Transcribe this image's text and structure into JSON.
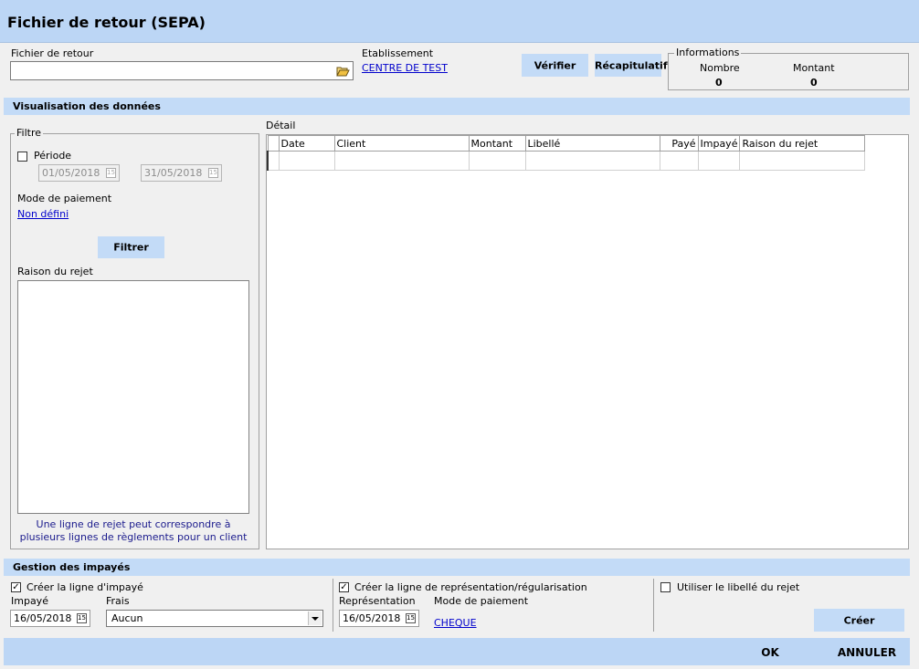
{
  "window": {
    "title": "Fichier de retour (SEPA)"
  },
  "header": {
    "fichier_label": "Fichier de retour",
    "fichier_value": "",
    "etablissement_label": "Etablissement",
    "etablissement_value": "CENTRE DE TEST",
    "verifier_label": "Vérifier",
    "recap_label": "Récapitulatif"
  },
  "informations": {
    "legend": "Informations",
    "nombre_label": "Nombre",
    "nombre_value": "0",
    "montant_label": "Montant",
    "montant_value": "0"
  },
  "visualisation": {
    "title": "Visualisation des données"
  },
  "filtre": {
    "legend": "Filtre",
    "periode_label": "Période",
    "periode_checked": false,
    "date_from": "01/05/2018",
    "date_to": "31/05/2018",
    "mode_label": "Mode de paiement",
    "mode_value": "Non défini",
    "filtrer_label": "Filtrer",
    "raison_label": "Raison du rejet",
    "note": "Une ligne de rejet peut correspondre à plusieurs lignes de règlements pour un client"
  },
  "detail": {
    "label": "Détail",
    "columns": [
      "Date",
      "Client",
      "Montant",
      "Libellé",
      "Payé",
      "Impayé",
      "Raison du rejet"
    ]
  },
  "gestion": {
    "title": "Gestion des impayés",
    "creer_impaye_label": "Créer la ligne d'impayé",
    "creer_impaye_checked": true,
    "impaye_label": "Impayé",
    "impaye_date": "16/05/2018",
    "frais_label": "Frais",
    "frais_value": "Aucun",
    "creer_repr_label": "Créer la ligne de représentation/régularisation",
    "creer_repr_checked": true,
    "representation_label": "Représentation",
    "representation_date": "16/05/2018",
    "mode_label": "Mode de paiement",
    "mode_value": "CHEQUE",
    "utiliser_label": "Utiliser le libellé du rejet",
    "utiliser_checked": false,
    "creer_button": "Créer"
  },
  "footer": {
    "ok_label": "OK",
    "annuler_label": "ANNULER"
  }
}
